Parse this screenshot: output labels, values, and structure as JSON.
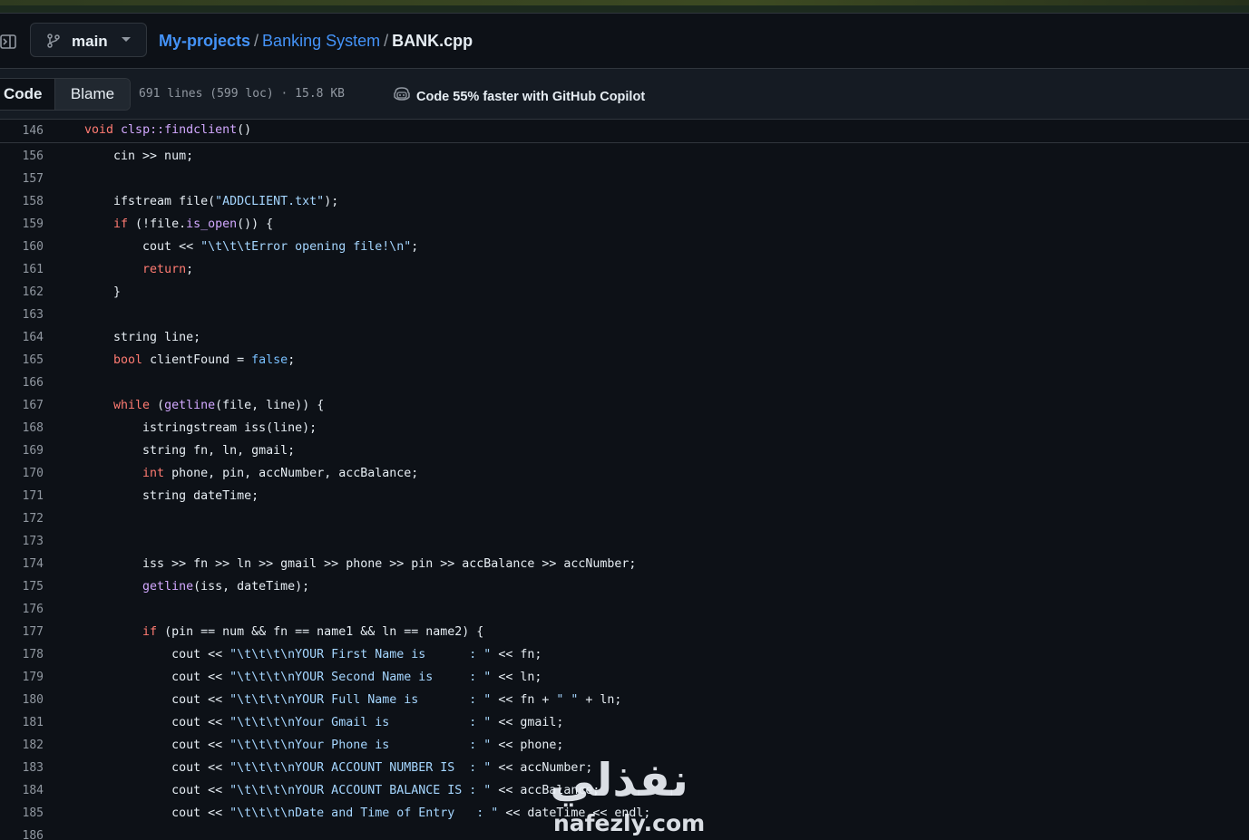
{
  "header": {
    "branch": "main",
    "breadcrumb": {
      "repo": "My-projects",
      "dir": "Banking System",
      "file": "BANK.cpp",
      "separator": "/"
    }
  },
  "toolbar": {
    "code_tab": "Code",
    "blame_tab": "Blame",
    "meta": "691 lines (599 loc) · 15.8 KB",
    "copilot": "Code 55% faster with GitHub Copilot"
  },
  "sticky": {
    "line_no": "146",
    "segments": [
      [
        "kw",
        "void"
      ],
      [
        "",
        "  "
      ],
      [
        "fnc",
        "clsp::findclient"
      ],
      [
        "",
        "()"
      ]
    ]
  },
  "code_lines": [
    {
      "n": "156",
      "s": [
        [
          "",
          "    cin >> num;"
        ]
      ]
    },
    {
      "n": "157",
      "s": []
    },
    {
      "n": "158",
      "s": [
        [
          "",
          "    ifstream file("
        ],
        [
          "str",
          "\"ADDCLIENT.txt\""
        ],
        [
          "",
          ");"
        ]
      ]
    },
    {
      "n": "159",
      "s": [
        [
          "",
          "    "
        ],
        [
          "kw",
          "if"
        ],
        [
          "",
          " (!file."
        ],
        [
          "fnc",
          "is_open"
        ],
        [
          "",
          "()) {"
        ]
      ]
    },
    {
      "n": "160",
      "s": [
        [
          "",
          "        cout << "
        ],
        [
          "str",
          "\"\\t\\t\\tError opening file!\\n\""
        ],
        [
          "",
          ";"
        ]
      ]
    },
    {
      "n": "161",
      "s": [
        [
          "",
          "        "
        ],
        [
          "kw",
          "return"
        ],
        [
          "",
          ";"
        ]
      ]
    },
    {
      "n": "162",
      "s": [
        [
          "",
          "    }"
        ]
      ]
    },
    {
      "n": "163",
      "s": []
    },
    {
      "n": "164",
      "s": [
        [
          "",
          "    string line;"
        ]
      ]
    },
    {
      "n": "165",
      "s": [
        [
          "",
          "    "
        ],
        [
          "kw",
          "bool"
        ],
        [
          "",
          " clientFound = "
        ],
        [
          "blue",
          "false"
        ],
        [
          "",
          ";"
        ]
      ]
    },
    {
      "n": "166",
      "s": []
    },
    {
      "n": "167",
      "s": [
        [
          "",
          "    "
        ],
        [
          "kw",
          "while"
        ],
        [
          "",
          " ("
        ],
        [
          "fnc",
          "getline"
        ],
        [
          "",
          "(file, line)) {"
        ]
      ]
    },
    {
      "n": "168",
      "s": [
        [
          "",
          "        istringstream iss(line);"
        ]
      ]
    },
    {
      "n": "169",
      "s": [
        [
          "",
          "        string fn, ln, gmail;"
        ]
      ]
    },
    {
      "n": "170",
      "s": [
        [
          "",
          "        "
        ],
        [
          "kw",
          "int"
        ],
        [
          "",
          " phone, pin, accNumber, accBalance;"
        ]
      ]
    },
    {
      "n": "171",
      "s": [
        [
          "",
          "        string dateTime;"
        ]
      ]
    },
    {
      "n": "172",
      "s": []
    },
    {
      "n": "173",
      "s": []
    },
    {
      "n": "174",
      "s": [
        [
          "",
          "        iss >> fn >> ln >> gmail >> phone >> pin >> accBalance >> accNumber;"
        ]
      ]
    },
    {
      "n": "175",
      "s": [
        [
          "",
          "        "
        ],
        [
          "fnc",
          "getline"
        ],
        [
          "",
          "(iss, dateTime);"
        ]
      ]
    },
    {
      "n": "176",
      "s": []
    },
    {
      "n": "177",
      "s": [
        [
          "",
          "        "
        ],
        [
          "kw",
          "if"
        ],
        [
          "",
          " (pin == num && fn == name1 && ln == name2) {"
        ]
      ]
    },
    {
      "n": "178",
      "s": [
        [
          "",
          "            cout << "
        ],
        [
          "str",
          "\"\\t\\t\\t\\nYOUR First Name is      : \""
        ],
        [
          "",
          " << fn;"
        ]
      ]
    },
    {
      "n": "179",
      "s": [
        [
          "",
          "            cout << "
        ],
        [
          "str",
          "\"\\t\\t\\t\\nYOUR Second Name is     : \""
        ],
        [
          "",
          " << ln;"
        ]
      ]
    },
    {
      "n": "180",
      "s": [
        [
          "",
          "            cout << "
        ],
        [
          "str",
          "\"\\t\\t\\t\\nYOUR Full Name is       : \""
        ],
        [
          "",
          " << fn + "
        ],
        [
          "str",
          "\" \""
        ],
        [
          "",
          " + ln;"
        ]
      ]
    },
    {
      "n": "181",
      "s": [
        [
          "",
          "            cout << "
        ],
        [
          "str",
          "\"\\t\\t\\t\\nYour Gmail is           : \""
        ],
        [
          "",
          " << gmail;"
        ]
      ]
    },
    {
      "n": "182",
      "s": [
        [
          "",
          "            cout << "
        ],
        [
          "str",
          "\"\\t\\t\\t\\nYour Phone is           : \""
        ],
        [
          "",
          " << phone;"
        ]
      ]
    },
    {
      "n": "183",
      "s": [
        [
          "",
          "            cout << "
        ],
        [
          "str",
          "\"\\t\\t\\t\\nYOUR ACCOUNT NUMBER IS  : \""
        ],
        [
          "",
          " << accNumber;"
        ]
      ]
    },
    {
      "n": "184",
      "s": [
        [
          "",
          "            cout << "
        ],
        [
          "str",
          "\"\\t\\t\\t\\nYOUR ACCOUNT BALANCE IS : \""
        ],
        [
          "",
          " << accBalance;"
        ]
      ]
    },
    {
      "n": "185",
      "s": [
        [
          "",
          "            cout << "
        ],
        [
          "str",
          "\"\\t\\t\\t\\nDate and Time of Entry   : \""
        ],
        [
          "",
          " << dateTime << endl;"
        ]
      ]
    },
    {
      "n": "186",
      "s": []
    }
  ],
  "watermark": {
    "arabic": "نفذلي",
    "latin": "nafezly.com"
  },
  "icons": {
    "sidebar": "sidebar-expand-icon",
    "branch": "git-branch-icon",
    "copilot": "copilot-icon"
  },
  "colors": {
    "background": "#0d1117",
    "link": "#4493f8",
    "keyword": "#ff7b72",
    "function": "#d2a8ff",
    "string": "#a5d6ff",
    "constant": "#79c0ff"
  }
}
